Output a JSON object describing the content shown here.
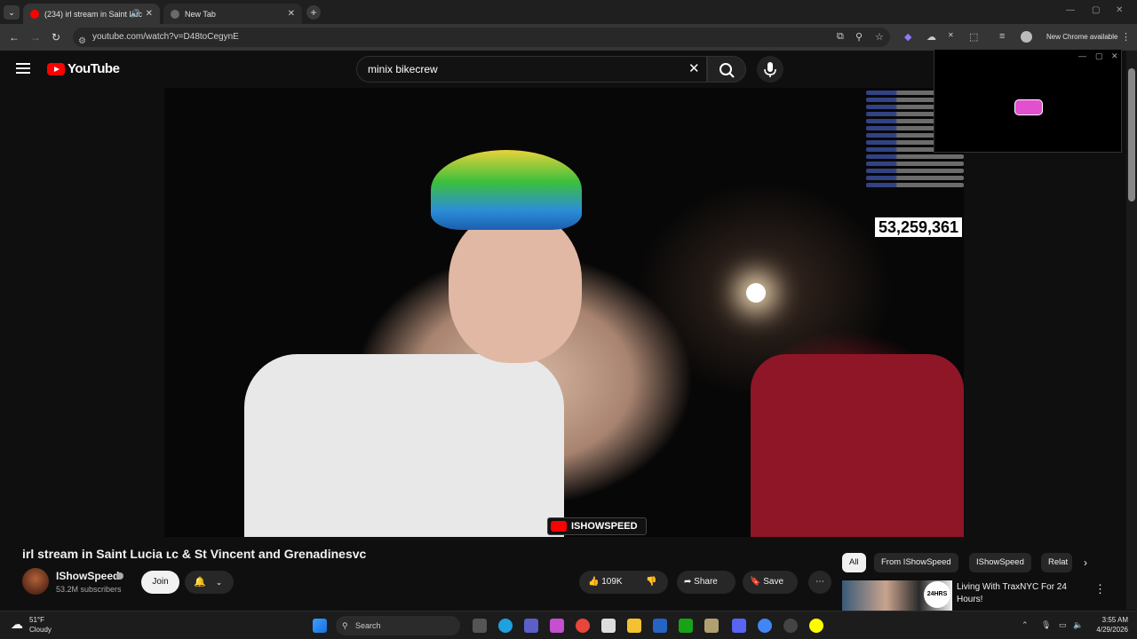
{
  "browser": {
    "tabs": [
      {
        "title": "(234) irl stream in Saint Luc",
        "active": true
      },
      {
        "title": "New Tab",
        "active": false
      }
    ],
    "url": "youtube.com/watch?v=D48toCegynE",
    "new_chrome": "New Chrome available"
  },
  "youtube": {
    "logo_text": "YouTube",
    "search_value": "minix bikecrew"
  },
  "video": {
    "view_count": "53,259,361",
    "watermark": "ISHOWSPEED",
    "title": "irl stream in Saint Lucia ʟᴄ & St Vincent and Grenadinesvc",
    "channel": "IShowSpeed",
    "subscribers": "53.2M subscribers",
    "join_label": "Join",
    "likes": "109K",
    "share_label": "Share",
    "save_label": "Save"
  },
  "sidebar": {
    "chips": [
      "All",
      "From IShowSpeed",
      "IShowSpeed",
      "Relat"
    ],
    "rec_title": "Living With TraxNYC For 24 Hours!",
    "rec_badge": "24HRS"
  },
  "taskbar": {
    "temp": "51°F",
    "condition": "Cloudy",
    "search_label": "Search",
    "time": "3:55 AM",
    "date": "4/29/2026"
  },
  "colors": {
    "youtube_red": "#ff0000",
    "discord_pink": "#e24fcf"
  }
}
